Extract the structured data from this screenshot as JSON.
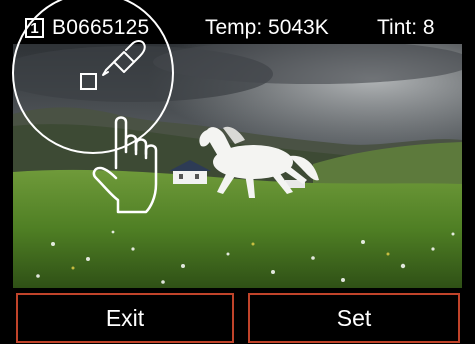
{
  "status_bar": {
    "slot_number": "1",
    "image_id": "B0665125",
    "temperature": "Temp: 5043K",
    "tint": "Tint: 8"
  },
  "buttons": {
    "exit_label": "Exit",
    "set_label": "Set"
  },
  "icons": {
    "pointer": "hand-pointer-icon",
    "sampler": "eyedropper-icon",
    "loupe": "magnifier-loupe"
  },
  "colors": {
    "button_border": "#c0432a",
    "text": "#ffffff",
    "background": "#000000"
  }
}
